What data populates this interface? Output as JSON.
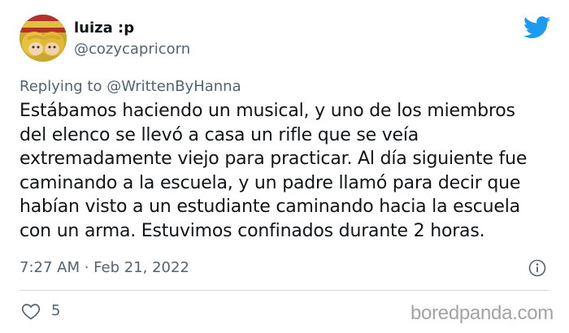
{
  "user": {
    "display_name": "luiza :p",
    "handle": "@cozycapricorn",
    "avatar": "avatar-photo"
  },
  "reply": {
    "text": "Replying to @WrittenByHanna"
  },
  "tweet": {
    "lines": [
      "Estábamos haciendo un musical, y uno de los miembros",
      "del elenco se llevó a casa un rifle que se veía",
      "extremadamente viejo para practicar. Al día siguiente fue",
      "caminando a la escuela, y un padre llamó para decir que",
      "habían visto a un estudiante caminando hacia la escuela",
      "con un arma. Estuvimos confinados durante 2 horas."
    ],
    "timestamp": "7:27 AM · Feb 21, 2022",
    "likes": "5"
  },
  "watermark": "boredpanda.com",
  "icons": {
    "bird": "twitter-bird-icon",
    "info": "info-icon",
    "heart": "heart-icon"
  },
  "colors": {
    "brand": "#1d9bf0",
    "text": "#0f1419",
    "secondary": "#536471",
    "divider": "#cfd9de",
    "watermark": "#a3a3a3"
  }
}
